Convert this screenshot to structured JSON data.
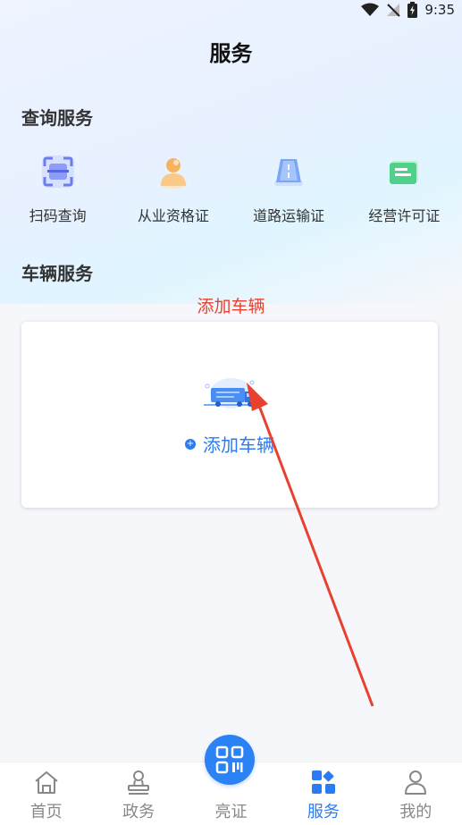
{
  "status": {
    "time": "9:35"
  },
  "header": {
    "title": "服务"
  },
  "query_section": {
    "title": "查询服务",
    "items": [
      {
        "label": "扫码查询",
        "icon": "scan-icon"
      },
      {
        "label": "从业资格证",
        "icon": "person-certificate-icon"
      },
      {
        "label": "道路运输证",
        "icon": "road-transport-icon"
      },
      {
        "label": "经营许可证",
        "icon": "business-license-icon"
      }
    ]
  },
  "vehicle_section": {
    "title": "车辆服务",
    "annotation": "添加车辆",
    "add_button": "添加车辆"
  },
  "tabbar": {
    "tabs": [
      {
        "label": "首页",
        "icon": "home-icon"
      },
      {
        "label": "政务",
        "icon": "stamp-icon"
      },
      {
        "label": "亮证",
        "icon": "qr-code-icon"
      },
      {
        "label": "服务",
        "icon": "services-grid-icon",
        "active": true
      },
      {
        "label": "我的",
        "icon": "user-icon"
      }
    ]
  },
  "colors": {
    "accent": "#2b7bf5",
    "annotation": "#e8412f"
  }
}
